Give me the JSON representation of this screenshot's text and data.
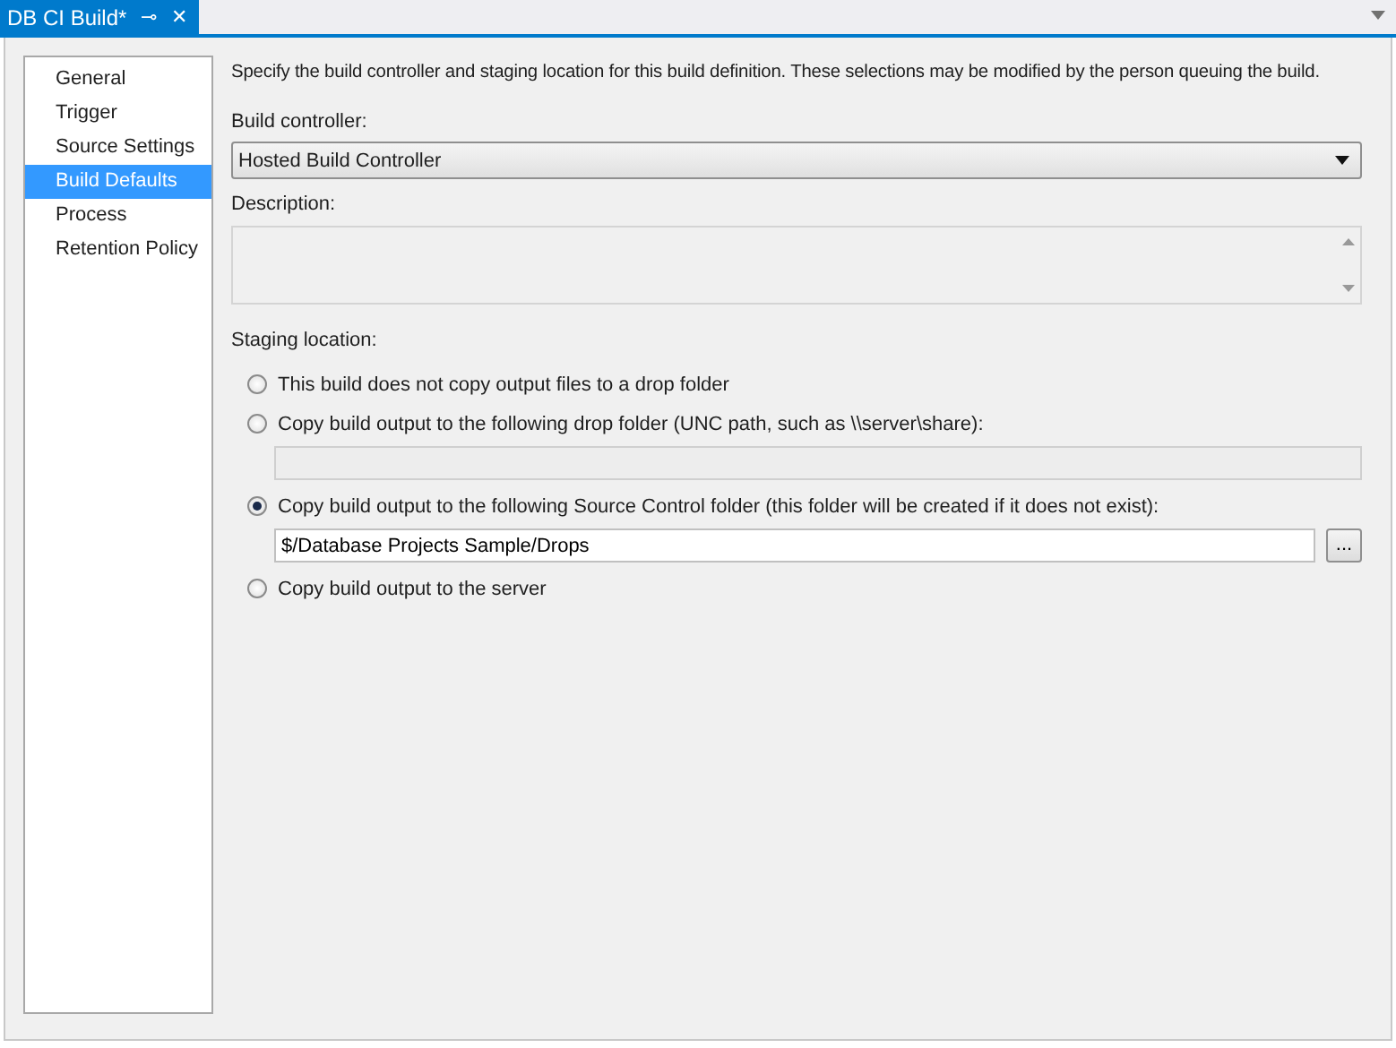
{
  "tab": {
    "title": "DB CI Build*",
    "pin": "⊸",
    "close": "✕"
  },
  "sidebar": {
    "items": [
      {
        "label": "General",
        "selected": false
      },
      {
        "label": "Trigger",
        "selected": false
      },
      {
        "label": "Source Settings",
        "selected": false
      },
      {
        "label": "Build Defaults",
        "selected": true
      },
      {
        "label": "Process",
        "selected": false
      },
      {
        "label": "Retention Policy",
        "selected": false
      }
    ]
  },
  "intro": "Specify the build controller and staging location for this build definition. These selections may be modified by the person queuing the build.",
  "build_controller": {
    "label": "Build controller:",
    "value": "Hosted Build Controller"
  },
  "description": {
    "label": "Description:"
  },
  "staging": {
    "label": "Staging location:",
    "options": [
      {
        "label": "This build does not copy output files to a drop folder",
        "selected": false
      },
      {
        "label": "Copy build output to the following drop folder (UNC path, such as \\\\server\\share):",
        "selected": false,
        "field": {
          "disabled": true
        }
      },
      {
        "label": "Copy build output to the following Source Control folder (this folder will be created if it does not exist):",
        "selected": true,
        "field": {
          "disabled": false,
          "value": "$/Database Projects Sample/Drops",
          "browse": "..."
        }
      },
      {
        "label": "Copy build output to the server",
        "selected": false
      }
    ]
  }
}
